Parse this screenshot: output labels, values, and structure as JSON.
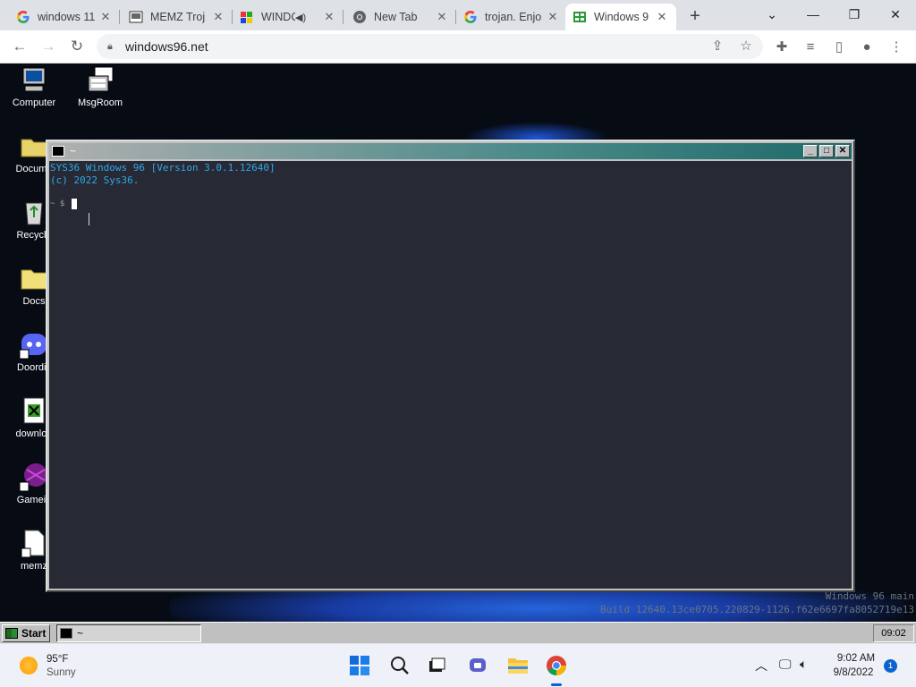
{
  "browser": {
    "tabs": [
      {
        "title": "windows 11",
        "icon": "google-g-icon",
        "active": false
      },
      {
        "title": "MEMZ Troj",
        "icon": "memz-icon",
        "active": false
      },
      {
        "title": "WINDO",
        "icon": "windows96-icon",
        "active": false,
        "audio": true
      },
      {
        "title": "New Tab",
        "icon": "chrome-icon",
        "active": false
      },
      {
        "title": "trojan. Enjo",
        "icon": "google-g-icon",
        "active": false
      },
      {
        "title": "Windows 9",
        "icon": "windows96-icon",
        "active": true
      }
    ],
    "url": "windows96.net"
  },
  "desktop": {
    "icons": [
      {
        "label": "Computer",
        "icon": "computer-icon"
      },
      {
        "label": "MsgRoom",
        "icon": "msgroom-icon"
      },
      {
        "label": "Docume",
        "icon": "folder-icon"
      },
      {
        "label": "Recycle",
        "icon": "recycle-bin-icon"
      },
      {
        "label": "Docs",
        "icon": "folder-icon"
      },
      {
        "label": "Doordis",
        "icon": "discord-icon"
      },
      {
        "label": "downloa",
        "icon": "download-icon"
      },
      {
        "label": "Gamein",
        "icon": "game-icon"
      },
      {
        "label": "memz",
        "icon": "file-icon"
      }
    ],
    "build_line1": "Windows 96 main",
    "build_line2": "Build 12640.13ce0705.220829-1126.f62e6697fa8052719e13"
  },
  "terminal": {
    "title": "~",
    "line1": "SYS36 Windows 96 [Version 3.0.1.12640]",
    "line2": "(c) 2022 Sys36.",
    "prompt": "~ $"
  },
  "w96_taskbar": {
    "start_label": "Start",
    "task_label": "~",
    "clock": "09:02"
  },
  "os_taskbar": {
    "weather_temp": "95°F",
    "weather_cond": "Sunny",
    "time": "9:02 AM",
    "date": "9/8/2022",
    "notifications": "1"
  },
  "colors": {
    "terminal_text": "#31a7e8",
    "terminal_bg": "#272a34",
    "title_gradient_end": "#1f6a6a",
    "desktop_bg": "#060b14"
  }
}
